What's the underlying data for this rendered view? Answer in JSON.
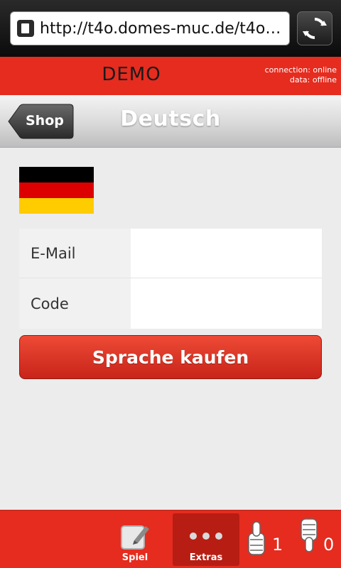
{
  "browser": {
    "url": "http://t4o.domes-muc.de/t4o/in..."
  },
  "header": {
    "title": "DEMO",
    "connection_status": "connection: online",
    "data_status": "data: offline"
  },
  "toolbar": {
    "back_label": "Shop",
    "title": "Deutsch"
  },
  "flag": {
    "colors": [
      "#000000",
      "#dd0000",
      "#ffcc00"
    ]
  },
  "form": {
    "email_label": "E-Mail",
    "email_value": "",
    "code_label": "Code",
    "code_value": ""
  },
  "buy_button": {
    "label": "Sprache kaufen"
  },
  "tabbar": {
    "tabs": [
      {
        "label": "Spiel",
        "icon": "edit-icon"
      },
      {
        "label": "Extras",
        "icon": "more-dots-icon",
        "active": true
      }
    ],
    "likes": "1",
    "dislikes": "0"
  },
  "colors": {
    "brand_red": "#e52c1f",
    "button_red": "#d42e1f"
  }
}
